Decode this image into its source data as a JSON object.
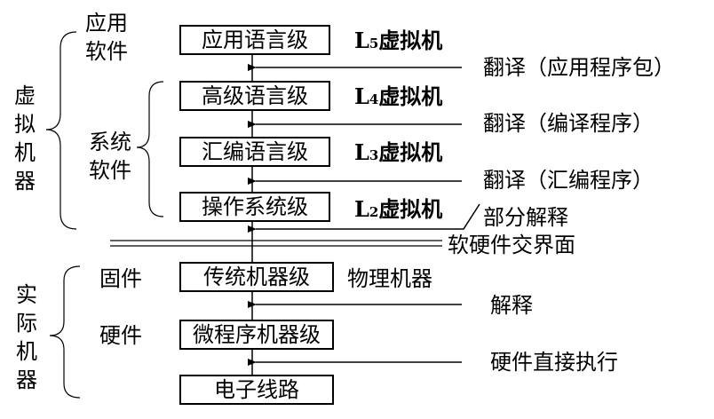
{
  "levels": {
    "app": "应用语言级",
    "high": "高级语言级",
    "asm": "汇编语言级",
    "os": "操作系统级",
    "machine": "传统机器级",
    "micro": "微程序机器级",
    "logic": "电子线路"
  },
  "vm": {
    "l5": {
      "letter": "L",
      "sub": "5",
      "text": "虚拟机"
    },
    "l4": {
      "letter": "L",
      "sub": "4",
      "text": "虚拟机"
    },
    "l3": {
      "letter": "L",
      "sub": "3",
      "text": "虚拟机"
    },
    "l2": {
      "letter": "L",
      "sub": "2",
      "text": "虚拟机"
    },
    "physical": "物理机器"
  },
  "transitions": {
    "t1": "翻译（应用程序包）",
    "t2": "翻译（编译程序）",
    "t3": "翻译（汇编程序）",
    "t4": "部分解释",
    "boundary": "软硬件交界面",
    "t5": "解释",
    "t6": "硬件直接执行"
  },
  "groups": {
    "app_software": [
      "应用",
      "软件"
    ],
    "system_software": [
      "系统",
      "软件"
    ],
    "firmware": "固件",
    "hardware": "硬件",
    "virtual_machine": "虚拟机器",
    "real_machine": "实际机器"
  }
}
